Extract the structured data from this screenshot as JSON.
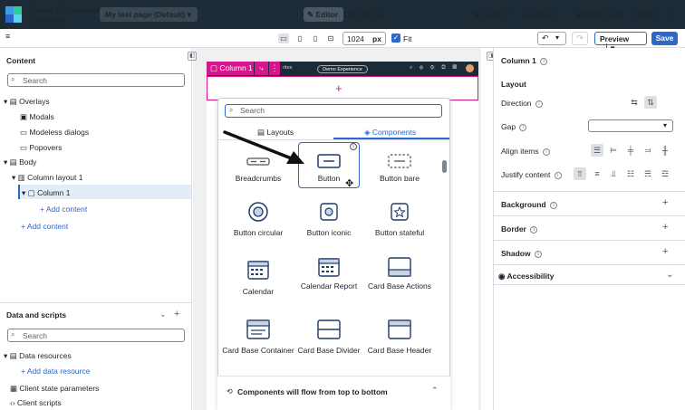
{
  "topbar": {
    "app_title": "Demo Experience",
    "app_subtitle": "Experience",
    "page_selector": "My test page (Default)",
    "editor_label": "Editor",
    "settings_label": "Settings",
    "scope_label": "global",
    "language_label": "Global",
    "whats_new_label": "What's new",
    "help_label": "Help"
  },
  "toolbar": {
    "width_value": "1024",
    "width_unit": "px",
    "fit_label": "Fit",
    "preview_label": "Preview",
    "save_label": "Save"
  },
  "left_panel": {
    "content_title": "Content",
    "search_placeholder": "Search",
    "tree": {
      "overlays": "Overlays",
      "modals": "Modals",
      "modeless": "Modeless dialogs",
      "popovers": "Popovers",
      "body": "Body",
      "column_layout": "Column layout 1",
      "column": "Column 1",
      "add_content_inner": "Add content",
      "add_content_outer": "Add content"
    },
    "data_title": "Data and scripts",
    "data_search_placeholder": "Search",
    "data_resources": "Data resources",
    "add_data_resource": "Add data resource",
    "client_state": "Client state parameters",
    "client_scripts": "Client scripts"
  },
  "canvas": {
    "column_tag": "Column 1",
    "header_pill": "Demo Experience",
    "header_fragment": "rites"
  },
  "picker": {
    "search_placeholder": "Search",
    "tab_layouts": "Layouts",
    "tab_components": "Components",
    "components": [
      "Breadcrumbs",
      "Button",
      "Button bare",
      "Button circular",
      "Button iconic",
      "Button stateful",
      "Calendar",
      "Calendar Report",
      "Card Base Actions",
      "Card Base Container",
      "Card Base Divider",
      "Card Base Header"
    ],
    "footer_text": "Components will flow from top to bottom"
  },
  "right_panel": {
    "title": "Column 1",
    "layout_title": "Layout",
    "direction_label": "Direction",
    "gap_label": "Gap",
    "align_label": "Align items",
    "justify_label": "Justify content",
    "background_label": "Background",
    "border_label": "Border",
    "shadow_label": "Shadow",
    "accessibility_label": "Accessibility"
  },
  "colors": {
    "topbar_bg": "#1d2b36",
    "accent": "#2d67c8",
    "selection_pink": "#d6168b"
  }
}
